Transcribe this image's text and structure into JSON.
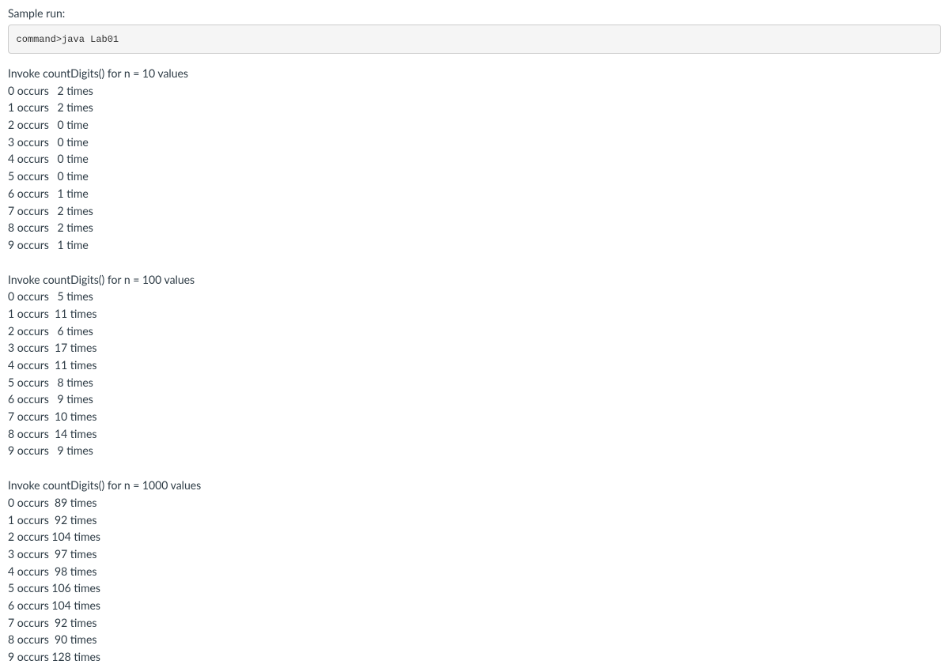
{
  "sampleLabel": "Sample run:",
  "command": "command>java Lab01",
  "groups": [
    {
      "header": "Invoke countDigits() for n = 10 values",
      "rows": [
        {
          "digit": 0,
          "count": 2,
          "unit": "times"
        },
        {
          "digit": 1,
          "count": 2,
          "unit": "times"
        },
        {
          "digit": 2,
          "count": 0,
          "unit": "time"
        },
        {
          "digit": 3,
          "count": 0,
          "unit": "time"
        },
        {
          "digit": 4,
          "count": 0,
          "unit": "time"
        },
        {
          "digit": 5,
          "count": 0,
          "unit": "time"
        },
        {
          "digit": 6,
          "count": 1,
          "unit": "time"
        },
        {
          "digit": 7,
          "count": 2,
          "unit": "times"
        },
        {
          "digit": 8,
          "count": 2,
          "unit": "times"
        },
        {
          "digit": 9,
          "count": 1,
          "unit": "time"
        }
      ]
    },
    {
      "header": "Invoke countDigits() for n = 100 values",
      "rows": [
        {
          "digit": 0,
          "count": 5,
          "unit": "times"
        },
        {
          "digit": 1,
          "count": 11,
          "unit": "times"
        },
        {
          "digit": 2,
          "count": 6,
          "unit": "times"
        },
        {
          "digit": 3,
          "count": 17,
          "unit": "times"
        },
        {
          "digit": 4,
          "count": 11,
          "unit": "times"
        },
        {
          "digit": 5,
          "count": 8,
          "unit": "times"
        },
        {
          "digit": 6,
          "count": 9,
          "unit": "times"
        },
        {
          "digit": 7,
          "count": 10,
          "unit": "times"
        },
        {
          "digit": 8,
          "count": 14,
          "unit": "times"
        },
        {
          "digit": 9,
          "count": 9,
          "unit": "times"
        }
      ]
    },
    {
      "header": "Invoke countDigits() for n = 1000 values",
      "rows": [
        {
          "digit": 0,
          "count": 89,
          "unit": "times"
        },
        {
          "digit": 1,
          "count": 92,
          "unit": "times"
        },
        {
          "digit": 2,
          "count": 104,
          "unit": "times"
        },
        {
          "digit": 3,
          "count": 97,
          "unit": "times"
        },
        {
          "digit": 4,
          "count": 98,
          "unit": "times"
        },
        {
          "digit": 5,
          "count": 106,
          "unit": "times"
        },
        {
          "digit": 6,
          "count": 104,
          "unit": "times"
        },
        {
          "digit": 7,
          "count": 92,
          "unit": "times"
        },
        {
          "digit": 8,
          "count": 90,
          "unit": "times"
        },
        {
          "digit": 9,
          "count": 128,
          "unit": "times"
        }
      ]
    }
  ]
}
